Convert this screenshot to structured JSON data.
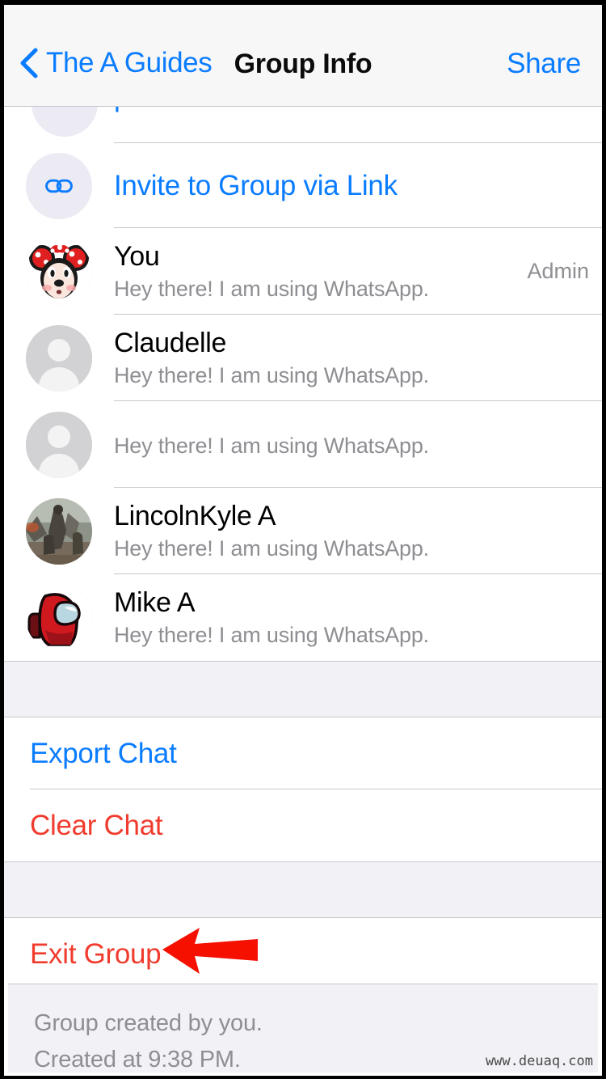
{
  "navbar": {
    "back_icon": "chevron-left-icon",
    "back_label": "The A Guides",
    "title": "Group Info",
    "share_label": "Share"
  },
  "colors": {
    "accent_blue": "#0a7cff",
    "destructive_red": "#f03c2e",
    "annotation_red": "#f51000",
    "secondary_text": "#8e8e93",
    "band_background": "#f1f1f6",
    "navbar_background": "#f7f7f7",
    "separator": "#c8c7cc"
  },
  "partial_row": {
    "label": "p",
    "avatar": "placeholder-circle-avatar"
  },
  "invite_row": {
    "icon": "link-chain-icon",
    "label": "Invite to Group via Link"
  },
  "participants": [
    {
      "name": "You",
      "status": "Hey there! I am using WhatsApp.",
      "badge": "Admin",
      "avatar": "minnie-mouse-avatar"
    },
    {
      "name": "Claudelle",
      "status": "Hey there! I am using WhatsApp.",
      "badge": "",
      "avatar": "default-person-avatar"
    },
    {
      "name": "",
      "status": "Hey there! I am using WhatsApp.",
      "badge": "",
      "avatar": "default-person-avatar"
    },
    {
      "name": "LincolnKyle A",
      "status": "Hey there! I am using WhatsApp.",
      "badge": "",
      "avatar": "game-artwork-avatar"
    },
    {
      "name": "Mike A",
      "status": "Hey there! I am using WhatsApp.",
      "badge": "",
      "avatar": "among-us-crewmate-avatar"
    }
  ],
  "chat_actions": [
    {
      "label": "Export Chat",
      "style": "blue"
    },
    {
      "label": "Clear Chat",
      "style": "red"
    }
  ],
  "group_actions": [
    {
      "label": "Exit Group",
      "style": "red"
    }
  ],
  "annotation": {
    "shape": "left-pointing-arrow",
    "target": "Exit Group"
  },
  "footer": {
    "line1": "Group created by you.",
    "line2": "Created at 9:38 PM.",
    "watermark": "www.deuaq.com"
  }
}
